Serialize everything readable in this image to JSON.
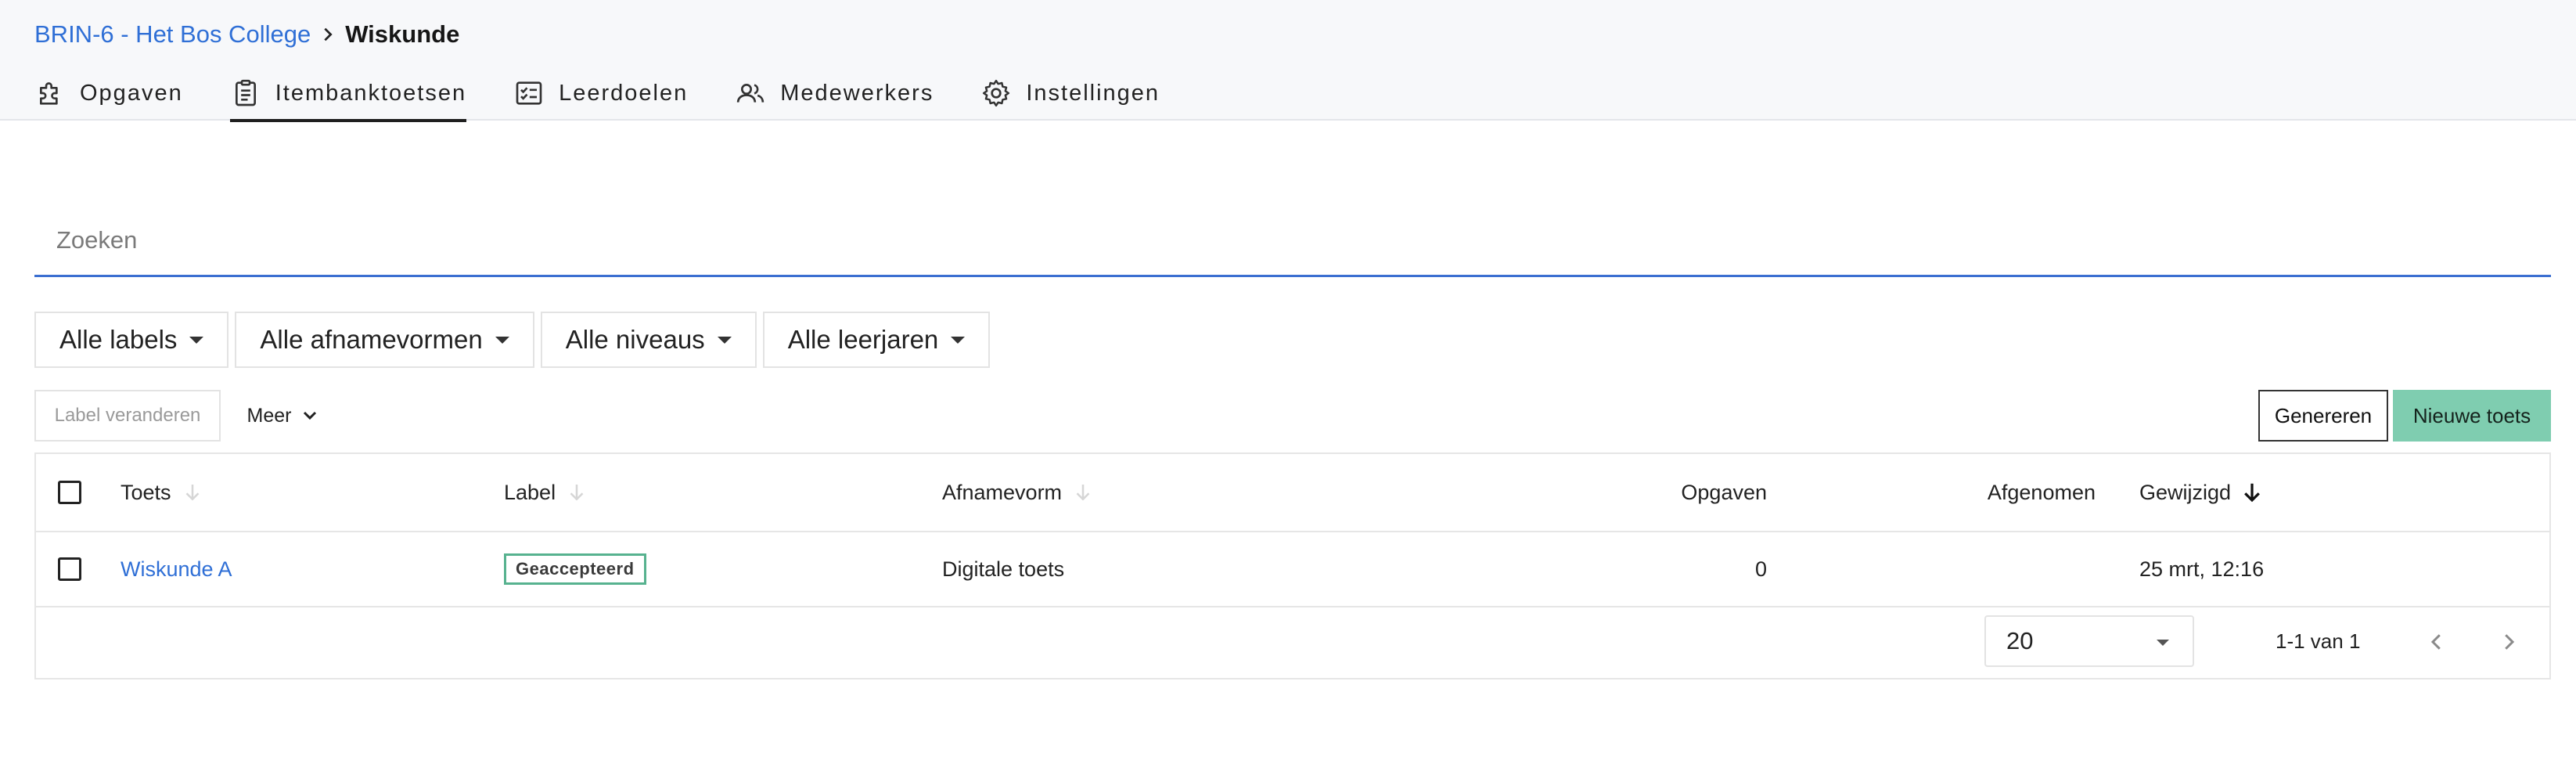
{
  "breadcrumb": {
    "parent": "BRIN-6 - Het Bos College",
    "current": "Wiskunde"
  },
  "tabs": [
    {
      "label": "Opgaven",
      "icon": "puzzle-icon"
    },
    {
      "label": "Itembanktoetsen",
      "icon": "clipboard-icon",
      "active": true
    },
    {
      "label": "Leerdoelen",
      "icon": "checklist-icon"
    },
    {
      "label": "Medewerkers",
      "icon": "people-icon"
    },
    {
      "label": "Instellingen",
      "icon": "gear-icon"
    }
  ],
  "search": {
    "placeholder": "Zoeken",
    "value": ""
  },
  "filters": [
    "Alle labels",
    "Alle afnamevormen",
    "Alle niveaus",
    "Alle leerjaren"
  ],
  "actions": {
    "label_change": "Label veranderen",
    "more": "Meer",
    "generate": "Genereren",
    "new_test": "Nieuwe toets"
  },
  "table": {
    "columns": {
      "toets": "Toets",
      "label": "Label",
      "afnamevorm": "Afnamevorm",
      "opgaven": "Opgaven",
      "afgenomen": "Afgenomen",
      "gewijzigd": "Gewijzigd"
    },
    "rows": [
      {
        "toets": "Wiskunde A",
        "label": "Geaccepteerd",
        "afnamevorm": "Digitale toets",
        "opgaven": "0",
        "afgenomen": "",
        "gewijzigd": "25 mrt, 12:16"
      }
    ]
  },
  "pagination": {
    "page_size": "20",
    "range": "1-1 van 1"
  },
  "colors": {
    "link": "#2f6fd6",
    "primary_button": "#7fcdb0",
    "badge_border": "#57b28f",
    "search_underline": "#3b6fd1"
  }
}
